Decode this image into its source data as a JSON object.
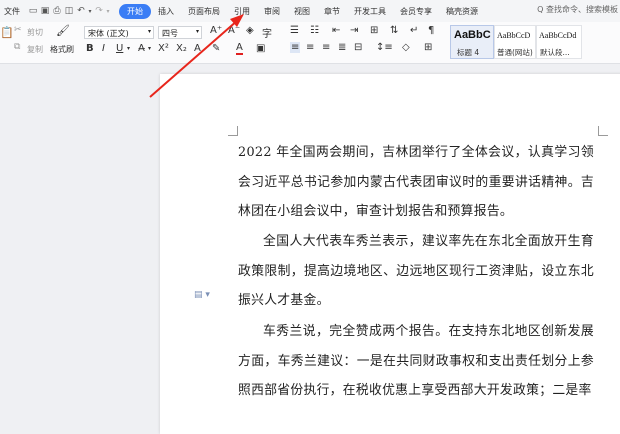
{
  "menubar": {
    "file": "文件",
    "tabs": [
      "开始",
      "插入",
      "页面布局",
      "引用",
      "审阅",
      "视图",
      "章节",
      "开发工具",
      "会员专享",
      "稿壳资源"
    ],
    "active_tab": "开始",
    "search_placeholder": "Q 查找命令、搜索模板"
  },
  "ribbon": {
    "cut": "剪切",
    "copy": "复制",
    "format_painter": "格式刷",
    "font_name": "宋体 (正文)",
    "font_size": "四号",
    "styles": [
      {
        "preview": "AaBbC",
        "name": "标题 4"
      },
      {
        "preview": "AaBbCcD",
        "name": "普通(网站)"
      },
      {
        "preview": "AaBbCcDd",
        "name": "默认段..."
      }
    ]
  },
  "document": {
    "paragraphs": [
      "2022 年全国两会期间，吉林团举行了全体会议，认真学习领会习近平总书记参加内蒙古代表团审议时的重要讲话精神。吉林团在小组会议中，审查计划报告和预算报告。",
      "全国人大代表车秀兰表示，建议率先在东北全面放开生育政策限制，提高边境地区、边远地区现行工资津贴，设立东北振兴人才基金。",
      "车秀兰说，完全赞成两个报告。在支持东北地区创新发展方面，车秀兰建议：一是在共同财政事权和支出责任划分上参照西部省份执行，在税收优惠上享受西部大开发政策；二是率"
    ]
  },
  "colors": {
    "accent": "#3a7df5",
    "arrow": "#e8261c"
  }
}
